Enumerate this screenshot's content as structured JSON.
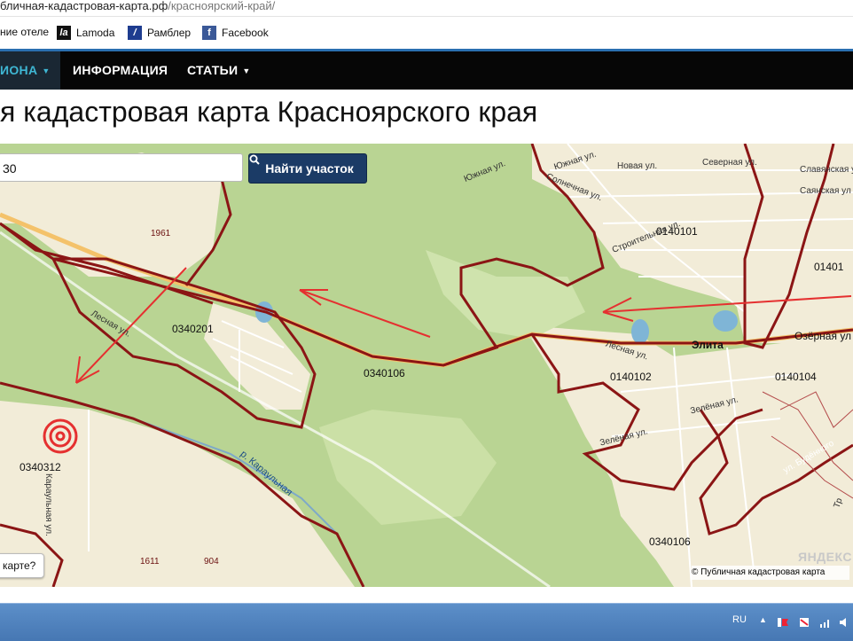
{
  "browser": {
    "url_domain": "бличная-кадастровая-карта.рф",
    "url_path": "/красноярский-край/"
  },
  "bookmarks": [
    {
      "label": "ние отеле",
      "icon": ""
    },
    {
      "label": "Lamoda",
      "icon": "la"
    },
    {
      "label": "Рамблер",
      "icon": "/"
    },
    {
      "label": "Facebook",
      "icon": "f"
    }
  ],
  "nav": {
    "region": "ИОНА",
    "info": "ИНФОРМАЦИЯ",
    "articles": "СТАТЬИ"
  },
  "page_title": "я кадастровая карта Красноярского края",
  "search": {
    "value": "30",
    "button_label": "Найти участок"
  },
  "help_button": "карте?",
  "map_labels": {
    "parcels": [
      "1961",
      "0340201",
      "0340106",
      "0340312",
      "0140101",
      "0140102",
      "0140104",
      "0340106",
      "1611",
      "904",
      "01401"
    ],
    "place": "Элита",
    "streets": {
      "yuzhnaya1": "Южная ул.",
      "yuzhnaya2": "Южная ул.",
      "novaya": "Новая ул.",
      "severnaya": "Северная ул.",
      "slavyanskaya": "Славянская ул",
      "sayanskaya": "Саянская ул",
      "solnechnaya": "Солнечная ул.",
      "stroitelnaya": "Строительная ул.",
      "ozernaya": "Озёрная ул",
      "lesnaya1": "Лесная ул.",
      "lesnaya2": "Лесная ул.",
      "zelenaya1": "Зелёная ул.",
      "zelenaya2": "Зелёная ул.",
      "karaulnaya": "Караульная ул.",
      "river": "р. Караульная",
      "budennogo": "ул. Будённого",
      "tr": "Тр"
    }
  },
  "credits": {
    "logo": "ЯНДЕКС",
    "text": "© Публичная кадастровая карта",
    "yandex": "© Яндекс"
  },
  "taskbar": {
    "lang": "RU"
  },
  "colors": {
    "nav_bg": "#060606",
    "nav_active": "#3fb7d4",
    "search_btn": "#1b3b66",
    "border_red": "#8b1515",
    "arrow_red": "#e53030",
    "map_green": "#b9d493",
    "urban_beige": "#f2ecd8"
  }
}
